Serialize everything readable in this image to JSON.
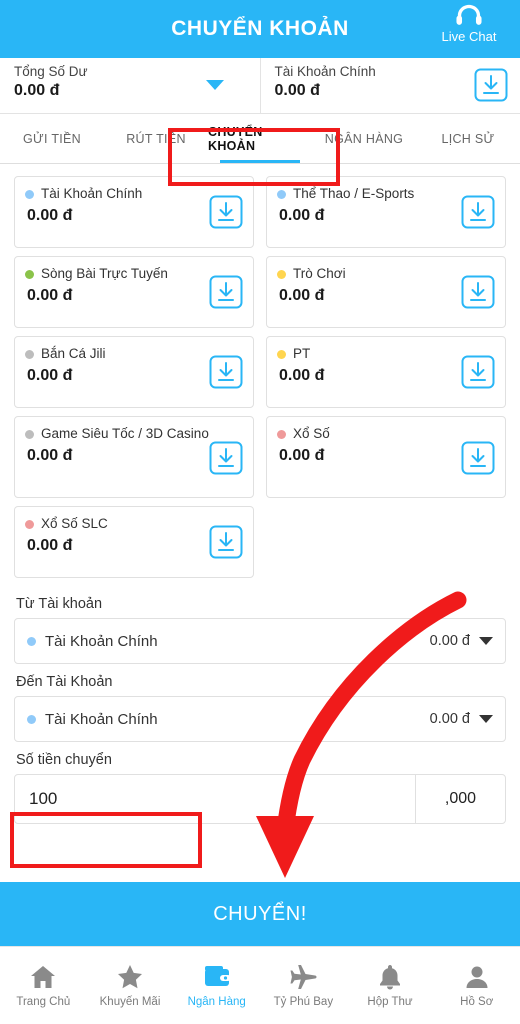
{
  "header": {
    "title": "CHUYỂN KHOẢN",
    "live_chat_label": "Live Chat",
    "headset_icon": "headset-icon"
  },
  "balance_bar": {
    "total": {
      "label": "Tổng Số Dư",
      "value": "0.00 đ",
      "caret_icon": "caret-down-icon"
    },
    "main": {
      "label": "Tài Khoản Chính",
      "value": "0.00 đ",
      "download_icon": "download-icon"
    }
  },
  "tabs": [
    {
      "label": "GỬI TIỀN",
      "active": false
    },
    {
      "label": "RÚT TIỀN",
      "active": false
    },
    {
      "label": "CHUYỂN KHOẢN",
      "active": true
    },
    {
      "label": "NGÂN HÀNG",
      "active": false
    },
    {
      "label": "LỊCH SỬ",
      "active": false
    }
  ],
  "wallets": [
    {
      "name": "Tài Khoản Chính",
      "value": "0.00 đ",
      "dot_color": "#90caf9",
      "icon": "download-icon"
    },
    {
      "name": "Thể Thao / E-Sports",
      "value": "0.00 đ",
      "dot_color": "#90caf9",
      "icon": "download-icon"
    },
    {
      "name": "Sòng Bài Trực Tuyến",
      "value": "0.00 đ",
      "dot_color": "#8bc34a",
      "icon": "download-icon"
    },
    {
      "name": "Trò Chơi",
      "value": "0.00 đ",
      "dot_color": "#ffd54f",
      "icon": "download-icon"
    },
    {
      "name": "Bắn Cá Jili",
      "value": "0.00 đ",
      "dot_color": "#bdbdbd",
      "icon": "download-icon"
    },
    {
      "name": "PT",
      "value": "0.00 đ",
      "dot_color": "#ffd54f",
      "icon": "download-icon"
    },
    {
      "name": "Game Siêu Tốc / 3D Casino",
      "value": "0.00 đ",
      "dot_color": "#bdbdbd",
      "icon": "download-icon"
    },
    {
      "name": "Xổ Số",
      "value": "0.00 đ",
      "dot_color": "#ef9a9a",
      "icon": "download-icon"
    },
    {
      "name": "Xổ Số SLC",
      "value": "0.00 đ",
      "dot_color": "#ef9a9a",
      "icon": "download-icon"
    }
  ],
  "form": {
    "from_label": "Từ Tài khoản",
    "from_value": "Tài Khoản Chính",
    "from_amount": "0.00 đ",
    "to_label": "Đến Tài Khoản",
    "to_value": "Tài Khoản Chính",
    "to_amount": "0.00 đ",
    "amount_label": "Số tiền chuyển",
    "amount_value": "100",
    "amount_suffix": ",000",
    "amount_placeholder": "",
    "dropdown_icon": "chevron-down-icon"
  },
  "submit": {
    "label": "CHUYỂN!"
  },
  "bottom_nav": [
    {
      "label": "Trang Chủ",
      "icon": "home-icon",
      "active": false
    },
    {
      "label": "Khuyến Mãi",
      "icon": "star-icon",
      "active": false
    },
    {
      "label": "Ngân Hàng",
      "icon": "wallet-icon",
      "active": true
    },
    {
      "label": "Tỷ Phú Bay",
      "icon": "airplane-icon",
      "active": false
    },
    {
      "label": "Hộp Thư",
      "icon": "bell-icon",
      "active": false
    },
    {
      "label": "Hồ Sơ",
      "icon": "person-icon",
      "active": false
    }
  ],
  "annotations": {
    "highlight_color": "#f01b1b",
    "tab_highlight": "CHUYỂN KHOẢN",
    "amount_highlight": "100",
    "arrow_icon": "red-arrow-icon"
  },
  "colors": {
    "accent": "#29b6f6",
    "accent_text": "#ffffff",
    "annotation": "#f01b1b"
  }
}
